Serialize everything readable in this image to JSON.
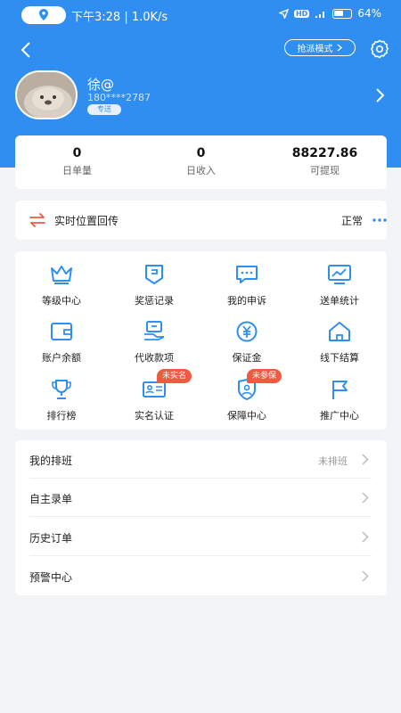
{
  "status_bar": {
    "time_speed": "下午3:28 | 1.0K/s",
    "hd": "HD",
    "battery": "64%",
    "battery_level": 0.64
  },
  "nav": {
    "grab_mode": "抢派模式"
  },
  "profile": {
    "name": "徐@",
    "phone": "180****2787",
    "tag": "专送"
  },
  "stats": [
    {
      "value": "0",
      "label": "日单量"
    },
    {
      "value": "0",
      "label": "日收入"
    },
    {
      "value": "88227.86",
      "label": "可提现"
    }
  ],
  "location": {
    "title": "实时位置回传",
    "status": "正常"
  },
  "grid": [
    {
      "label": "等级中心",
      "icon": "crown-icon"
    },
    {
      "label": "奖惩记录",
      "icon": "shield-flag-icon"
    },
    {
      "label": "我的申诉",
      "icon": "message-dots-icon"
    },
    {
      "label": "送单统计",
      "icon": "chart-monitor-icon"
    },
    {
      "label": "账户余额",
      "icon": "wallet-icon"
    },
    {
      "label": "代收款项",
      "icon": "collect-payment-icon"
    },
    {
      "label": "保证金",
      "icon": "yen-circle-icon"
    },
    {
      "label": "线下结算",
      "icon": "house-icon"
    },
    {
      "label": "排行榜",
      "icon": "trophy-icon"
    },
    {
      "label": "实名认证",
      "icon": "id-card-icon",
      "badge": "未实名"
    },
    {
      "label": "保障中心",
      "icon": "shield-person-icon",
      "badge": "未参保"
    },
    {
      "label": "推广中心",
      "icon": "flag-icon"
    }
  ],
  "menu": [
    {
      "label": "我的排班",
      "value": "未排班"
    },
    {
      "label": "自主录单",
      "value": ""
    },
    {
      "label": "历史订单",
      "value": ""
    },
    {
      "label": "预警中心",
      "value": ""
    }
  ],
  "colors": {
    "primary": "#2f8ef0",
    "badge": "#f05a40",
    "background": "#f3f4f6"
  }
}
